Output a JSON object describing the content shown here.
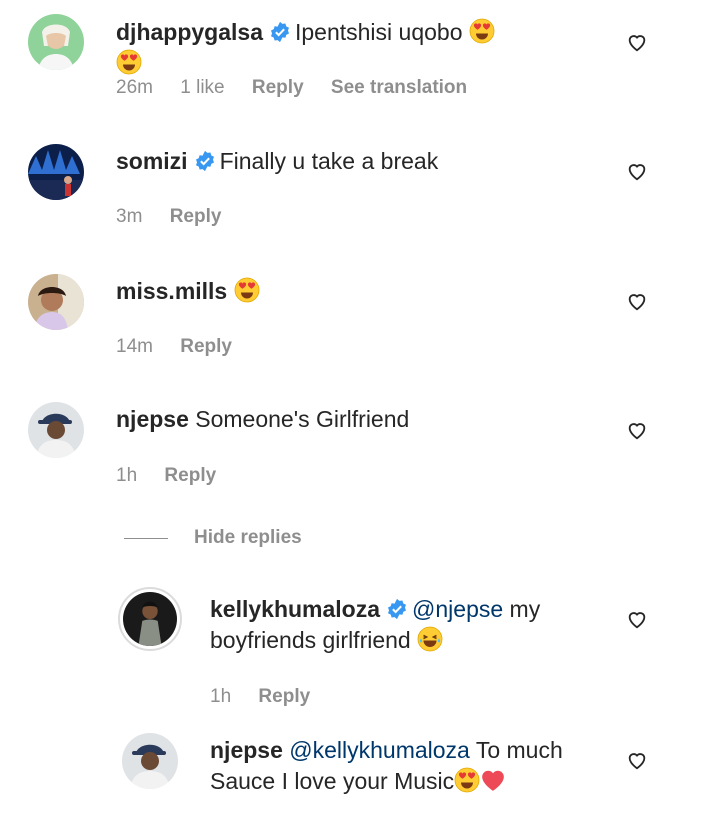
{
  "comments": [
    {
      "username": "djhappygalsa",
      "verified": true,
      "text": "Ipentshisi uqobo",
      "time": "26m",
      "likes": "1 like",
      "reply": "Reply",
      "translate": "See translation"
    },
    {
      "username": "somizi",
      "verified": true,
      "text": "Finally u take a break",
      "time": "3m",
      "reply": "Reply"
    },
    {
      "username": "miss.mills",
      "verified": false,
      "text": "",
      "time": "14m",
      "reply": "Reply"
    },
    {
      "username": "njepse",
      "verified": false,
      "text": "Someone's Girlfriend",
      "time": "1h",
      "reply": "Reply"
    }
  ],
  "hide_replies": "Hide replies",
  "replies": [
    {
      "username": "kellykhumaloza",
      "verified": true,
      "mention": "@njepse",
      "text": " my boyfriends girlfriend",
      "time": "1h",
      "reply": "Reply"
    },
    {
      "username": "njepse",
      "verified": false,
      "mention": "@kellykhumaloza",
      "text": " To much Sauce I love your Music",
      "time": "",
      "reply": ""
    }
  ],
  "colors": {
    "accent": "#3897f0",
    "mention": "#00376b",
    "muted": "#8e8e8e",
    "heart_red": "#ed4956"
  }
}
